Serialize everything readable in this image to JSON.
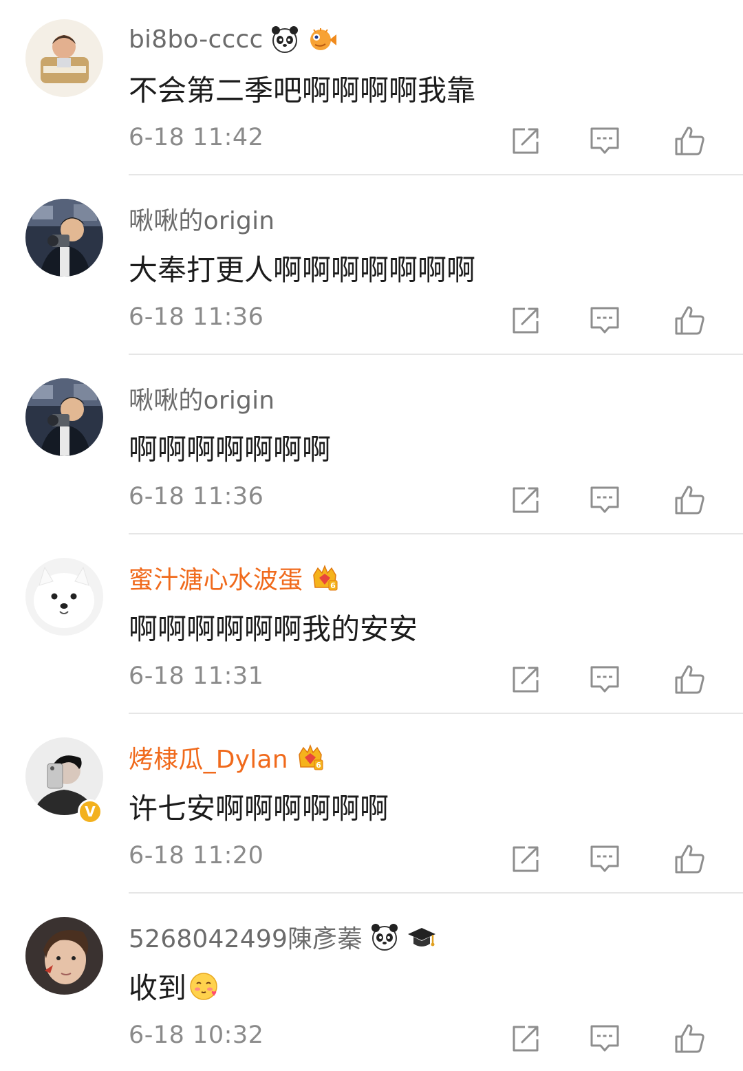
{
  "comments": [
    {
      "username": "bi8bo-cccc",
      "username_color": "#6b6b6b",
      "badges": [
        "panda-icon",
        "pufferfish-icon"
      ],
      "text": "不会第二季吧啊啊啊啊我靠",
      "time": "6-18 11:42",
      "verified": false
    },
    {
      "username": "啾啾的origin",
      "username_color": "#6b6b6b",
      "badges": [],
      "text": "大奉打更人啊啊啊啊啊啊啊",
      "time": "6-18 11:36",
      "verified": false
    },
    {
      "username": "啾啾的origin",
      "username_color": "#6b6b6b",
      "badges": [],
      "text": "啊啊啊啊啊啊啊",
      "time": "6-18 11:36",
      "verified": false
    },
    {
      "username": "蜜汁溏心水波蛋",
      "username_color": "#f06a1c",
      "badges": [
        "vip-crown-6-icon"
      ],
      "text": "啊啊啊啊啊啊我的安安",
      "time": "6-18 11:31",
      "verified": false
    },
    {
      "username": "烤棣瓜_Dylan",
      "username_color": "#f06a1c",
      "badges": [
        "vip-crown-6-icon"
      ],
      "text": "许七安啊啊啊啊啊啊",
      "time": "6-18 11:20",
      "verified": true
    },
    {
      "username": "5268042499陳彥蓁",
      "username_color": "#6b6b6b",
      "badges": [
        "panda-icon",
        "graduation-cap-icon"
      ],
      "text": "收到",
      "time": "6-18 10:32",
      "verified": false,
      "inline_emoji": "shy-face-emoji-icon"
    }
  ],
  "actions": [
    "share-icon",
    "reply-comment-icon",
    "like-thumbs-up-icon"
  ],
  "colors": {
    "username_default": "#6b6b6b",
    "username_vip": "#f06a1c",
    "timestamp": "#8a8a8a",
    "icon": "#8e8e8e",
    "divider": "#e6e6e6"
  }
}
